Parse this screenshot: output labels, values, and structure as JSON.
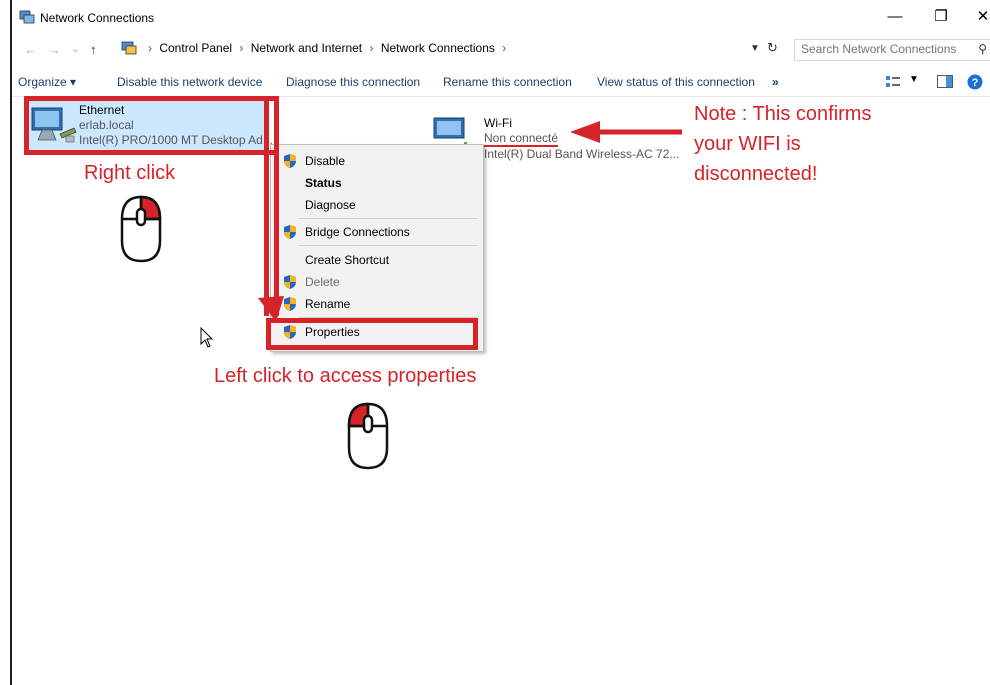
{
  "window": {
    "title": "Network Connections",
    "minimize_glyph": "—",
    "maximize_glyph": "❐",
    "close_glyph": "✕"
  },
  "nav": {
    "back": "←",
    "forward": "→",
    "recent": "⌄",
    "up": "↑"
  },
  "breadcrumb": {
    "items": [
      "Control Panel",
      "Network and Internet",
      "Network Connections"
    ],
    "separator": "›"
  },
  "search": {
    "placeholder": "Search Network Connections"
  },
  "toolbar": {
    "organize": "Organize ▾",
    "disable": "Disable this network device",
    "diagnose": "Diagnose this connection",
    "rename": "Rename this connection",
    "view_status": "View status of this connection",
    "more": "»"
  },
  "connections": {
    "ethernet": {
      "name": "Ethernet",
      "domain": "erlab.local",
      "adapter": "Intel(R) PRO/1000 MT Desktop Ad..."
    },
    "wifi": {
      "name": "Wi-Fi",
      "status": "Non connecté",
      "adapter": "Intel(R) Dual Band Wireless-AC 72..."
    }
  },
  "context_menu": {
    "disable": "Disable",
    "status": "Status",
    "diagnose": "Diagnose",
    "bridge": "Bridge Connections",
    "shortcut": "Create Shortcut",
    "delete": "Delete",
    "rename": "Rename",
    "properties": "Properties"
  },
  "annotations": {
    "right_click": "Right click",
    "left_click": "Left click to access properties",
    "note_line1": "Note : This confirms",
    "note_line2": "your WIFI is",
    "note_line3": "disconnected!"
  },
  "colors": {
    "accent_red": "#d6232a",
    "selection": "#cce8ff",
    "link_blue": "#1e3f6e"
  }
}
